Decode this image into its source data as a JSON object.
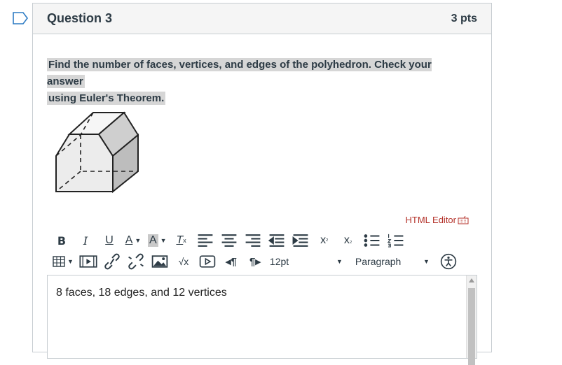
{
  "question": {
    "title": "Question 3",
    "points": "3 pts",
    "text_line1": "Find the number of faces, vertices, and edges of the polyhedron. Check your answer",
    "text_line2": "using Euler's Theorem."
  },
  "editor": {
    "html_editor_label": "HTML Editor",
    "font_size": "12pt",
    "block_format": "Paragraph",
    "content": "8 faces, 18 edges, and 12 vertices"
  },
  "toolbar": {
    "row1": [
      "bold-icon",
      "italic-icon",
      "underline-icon",
      "text-color-icon",
      "background-color-icon",
      "clear-formatting-icon",
      "align-left-icon",
      "align-center-icon",
      "align-right-icon",
      "outdent-icon",
      "indent-icon",
      "superscript-icon",
      "subscript-icon",
      "bullet-list-icon",
      "numbered-list-icon"
    ],
    "row2": [
      "table-icon",
      "media-icon",
      "link-icon",
      "unlink-icon",
      "image-icon",
      "equation-icon",
      "embed-icon",
      "ltr-icon",
      "rtl-icon",
      "accessibility-icon"
    ]
  },
  "colors": {
    "accent_red": "#b4322a",
    "highlight": "#d6d6d6",
    "border": "#c7cdd1",
    "text": "#2d3b45"
  }
}
